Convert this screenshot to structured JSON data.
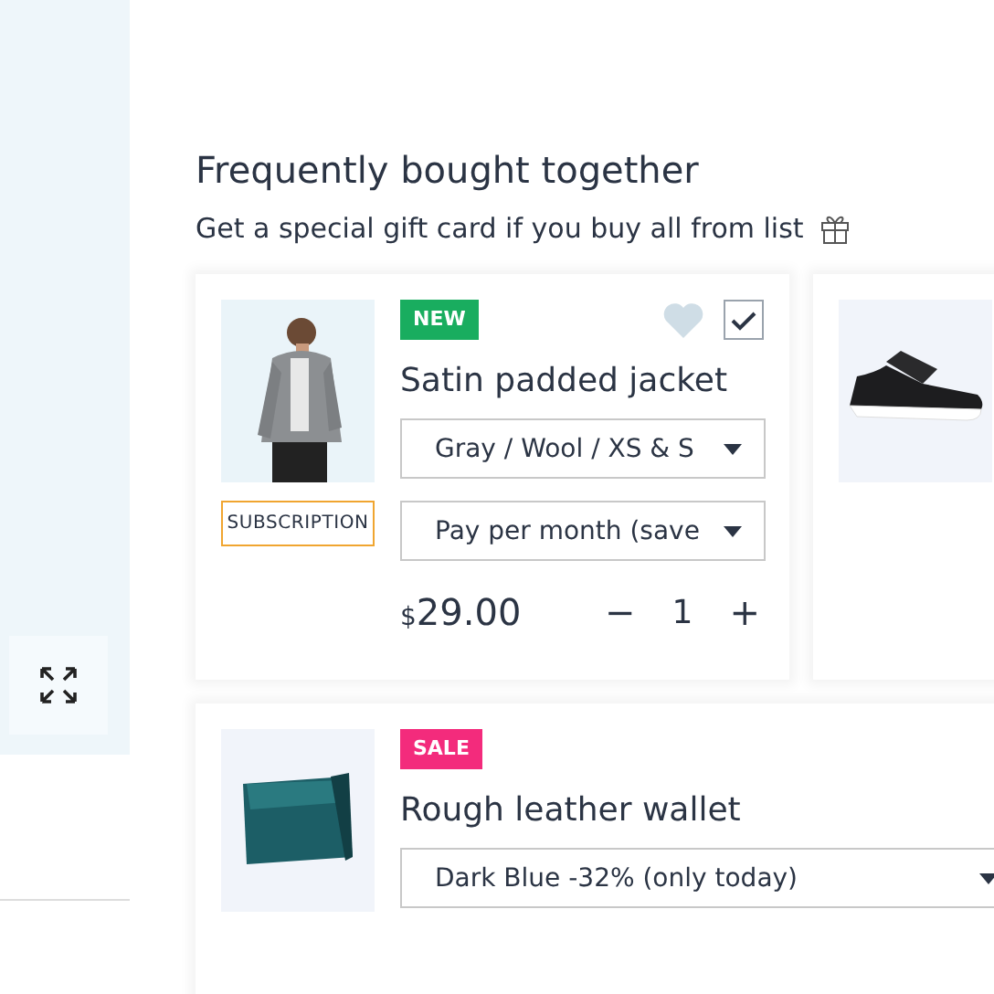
{
  "heading": "Frequently bought together",
  "subtitle": "Get a special gift card if you buy all from list",
  "products": [
    {
      "kind": "full",
      "badge": {
        "text": "NEW",
        "color": "#19ad5f"
      },
      "favorite": false,
      "checked": true,
      "title": "Satin padded jacket",
      "tag": "SUBSCRIPTION",
      "options": [
        "Gray / Wool / XS & S",
        "Pay per month (save"
      ],
      "currency": "$",
      "price": "29.00",
      "minus": "−",
      "quantity": "1",
      "plus": "+"
    },
    {
      "kind": "image_only"
    },
    {
      "kind": "partial",
      "badge": {
        "text": "SALE",
        "color": "#f32b7c"
      },
      "title": "Rough leather wallet",
      "options": [
        "Dark Blue -32% (only today)"
      ]
    }
  ]
}
